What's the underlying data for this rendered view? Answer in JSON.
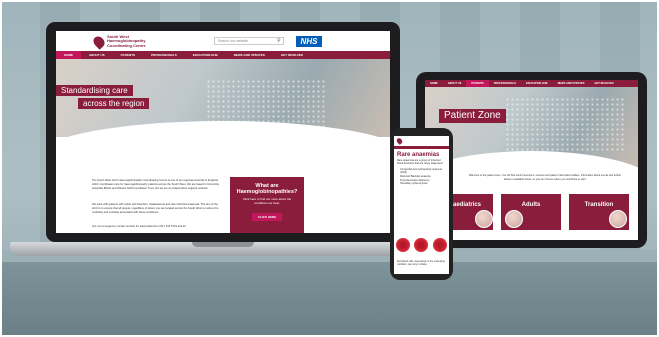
{
  "laptop": {
    "logo_text": "South West Haemoglobinopathy Coordinating Centre",
    "search_placeholder": "Search our website",
    "nhs": "NHS",
    "nav": [
      "HOME",
      "ABOUT US",
      "PATIENTS",
      "PROFESSIONALS",
      "EDUCATION HUB",
      "NEWS AND UPDATES",
      "GET INVOLVED"
    ],
    "hero_line1": "Standardising care",
    "hero_line2": "across the region",
    "paragraphs": [
      "The South West HCC Haemoglobinopathy Coordinating Centre is one of ten regional networks in England which coordinates care for haemoglobinopathy patients across the South West. We are based in University Hospitals Bristol and Weston NHS Foundation Trust, but we are an independent regional network.",
      "We work with patients with sickle cell disorders, thalassaemia and rare inherited anaemias. The aim of the HCC is to ensure that all people, regardless of where you are located across the South West to reduce the morbidity and mortality associated with these conditions.",
      "Our non-emergency contact number for adult patients is 0117 342 5719 and for"
    ],
    "cta_title": "What are Haemoglobinopathies?",
    "cta_sub": "Click here to find out more about the conditions we treat.",
    "cta_button": "CLICK HERE"
  },
  "tablet": {
    "nav": [
      "HOME",
      "ABOUT US",
      "PATIENTS",
      "PROFESSIONALS",
      "EDUCATION HUB",
      "NEWS AND UPDATES",
      "GET INVOLVED"
    ],
    "hero_title": "Patient Zone",
    "intro": "Welcome to the patient zone. You will find useful resources, services and patient information leaflets. Information about events and further advice is available below, so you can choose where you would like to start.",
    "cards": [
      "Paediatrics",
      "Adults",
      "Transition"
    ]
  },
  "phone": {
    "title": "Rare anaemias",
    "paragraph": "Rare anaemias are a group of inherited blood disorders that are rarely diagnosed.",
    "list": [
      "Congenital dyserythropoietic anaemia (CDA)",
      "Diamond Blackfan anaemia",
      "Pyruvate kinase deficiency",
      "Hereditary spherocytosis"
    ],
    "footer": "Red blood cells, depending on the underlying condition, can vary in shape."
  },
  "colors": {
    "brand": "#8a1d3c",
    "accent": "#c2185b",
    "nhs": "#005eb8"
  }
}
